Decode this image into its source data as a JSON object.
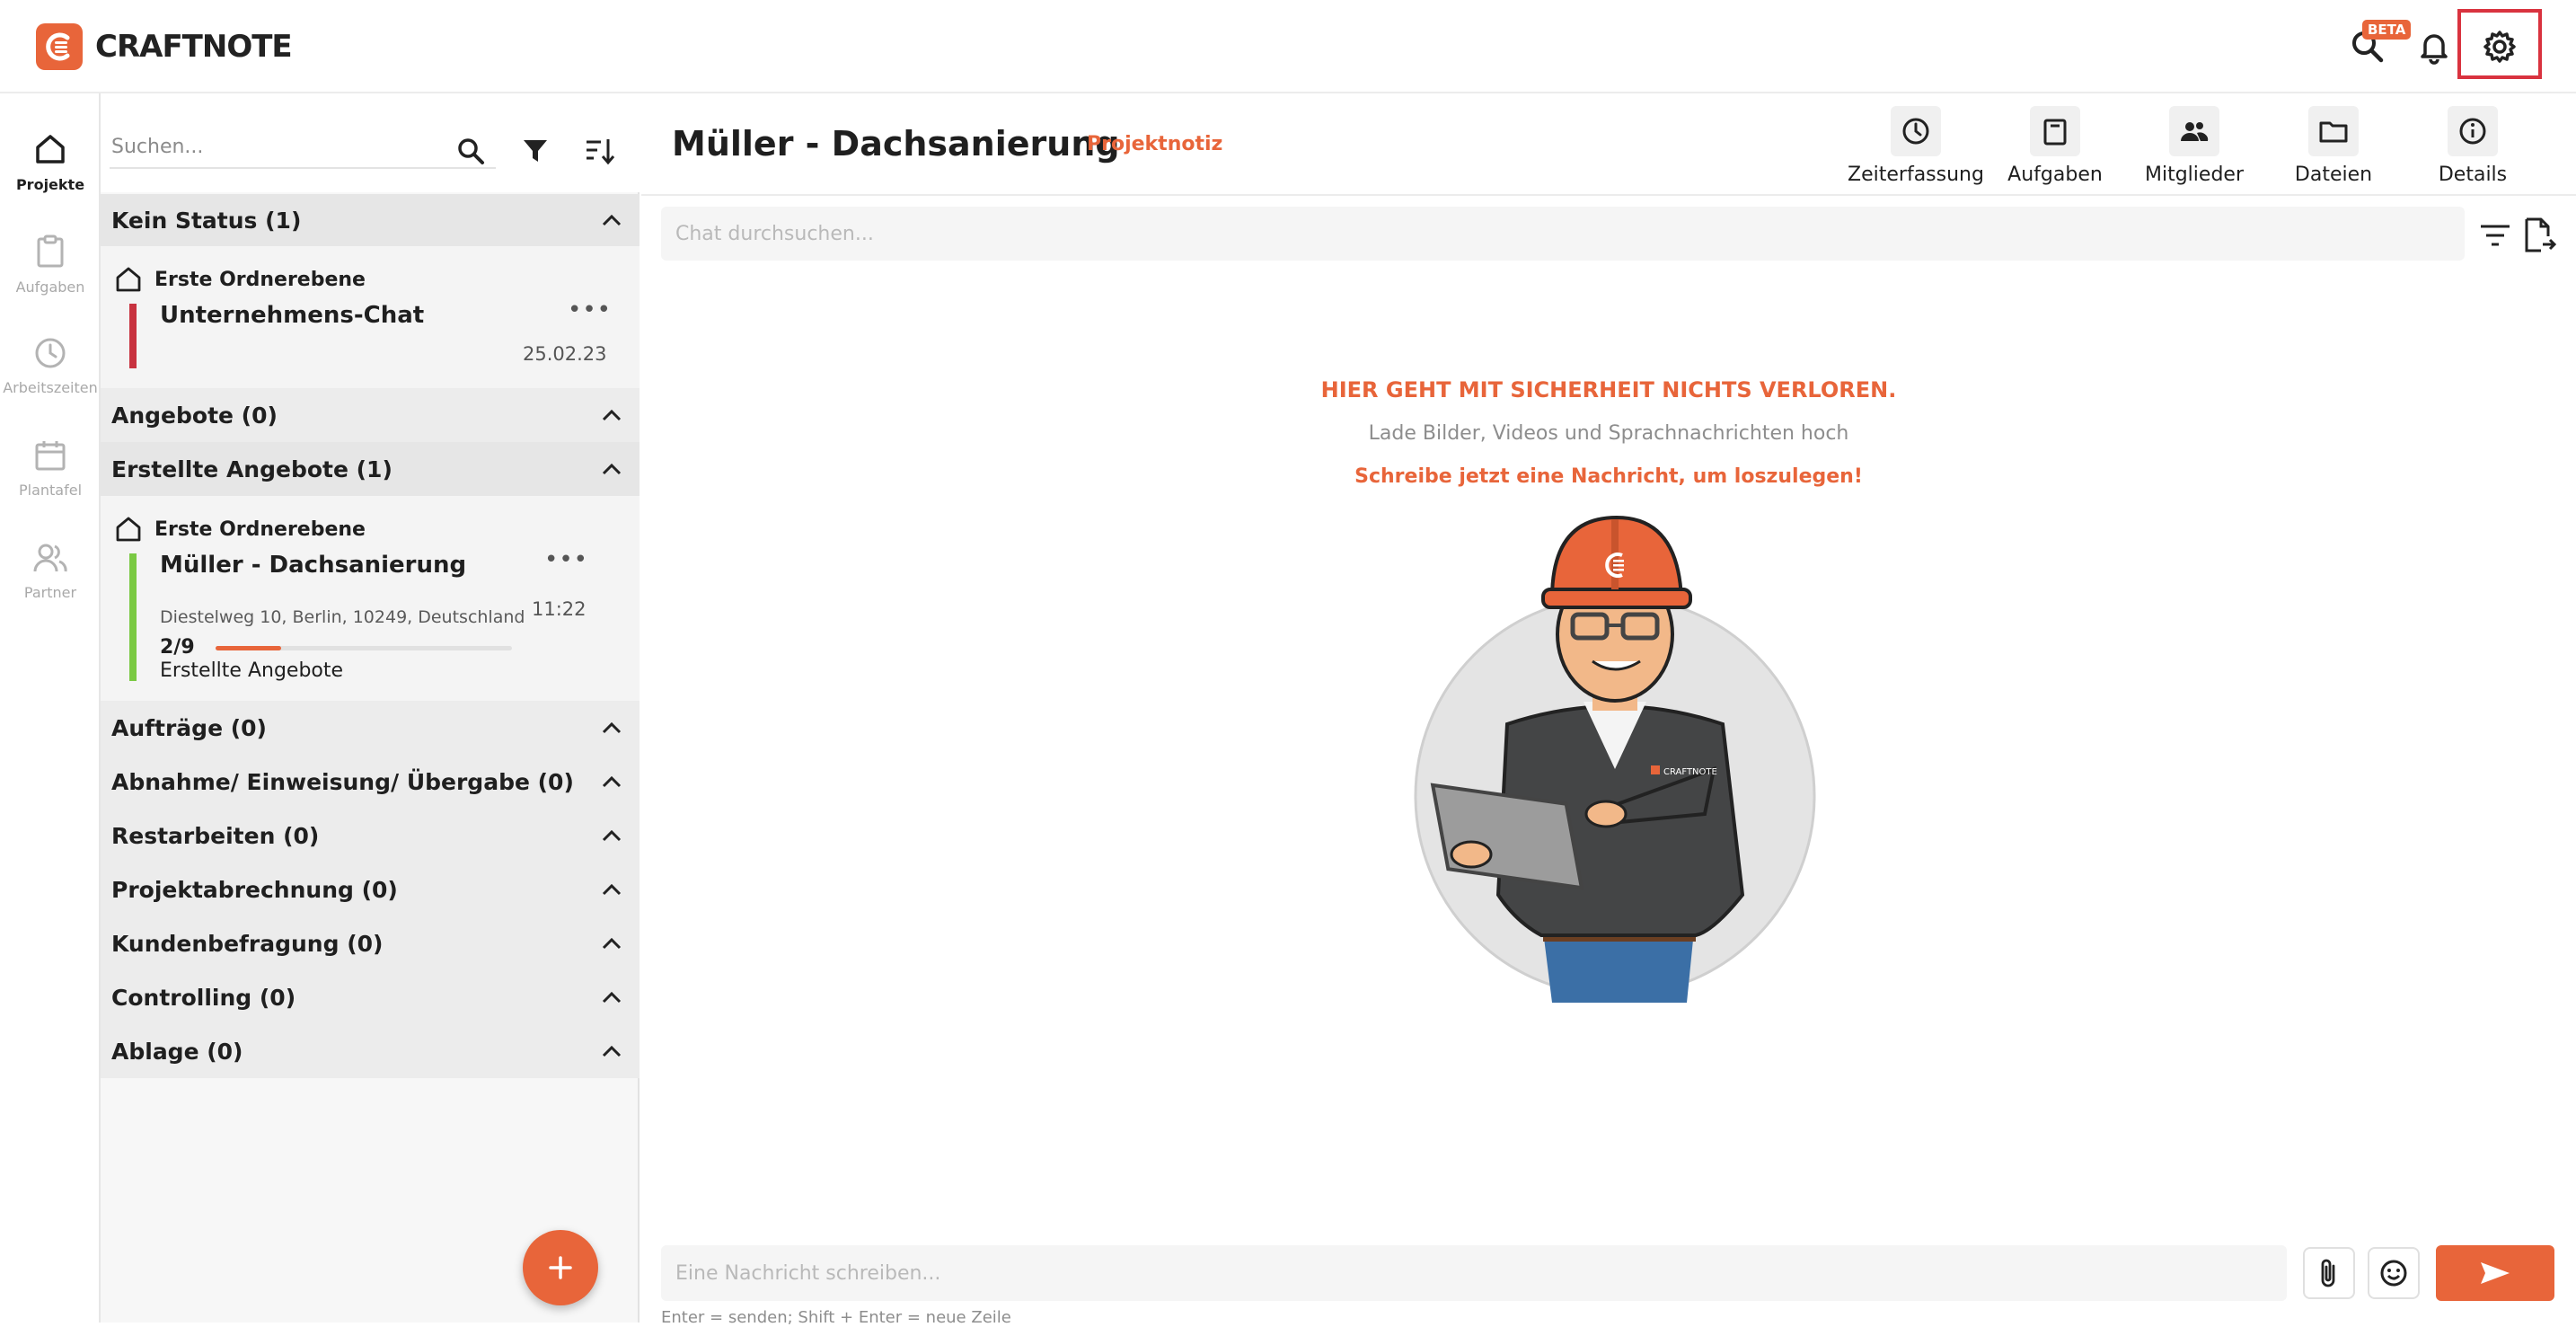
{
  "app": {
    "logo_text": "CRAFTNOTE",
    "beta_badge": "BETA"
  },
  "rail": [
    {
      "label": "Projekte"
    },
    {
      "label": "Aufgaben"
    },
    {
      "label": "Arbeitszeiten"
    },
    {
      "label": "Plantafel"
    },
    {
      "label": "Partner"
    }
  ],
  "list": {
    "search_placeholder": "Suchen...",
    "groups": [
      {
        "title": "Kein Status (1)"
      },
      {
        "title": "Angebote (0)"
      },
      {
        "title": "Erstellte Angebote (1)"
      },
      {
        "title": "Aufträge (0)"
      },
      {
        "title": "Abnahme/ Einweisung/ Übergabe (0)"
      },
      {
        "title": "Restarbeiten (0)"
      },
      {
        "title": "Projektabrechnung (0)"
      },
      {
        "title": "Kundenbefragung (0)"
      },
      {
        "title": "Controlling (0)"
      },
      {
        "title": "Ablage (0)"
      }
    ],
    "projects": [
      {
        "folder": "Erste Ordnerebene",
        "title": "Unternehmens-Chat",
        "date": "25.02.23",
        "status_color": "#c8323f"
      },
      {
        "folder": "Erste Ordnerebene",
        "title": "Müller - Dachsanierung",
        "address": "Diestelweg 10, Berlin, 10249, Deutschland",
        "count": "2/9",
        "progress": 0.22,
        "status": "Erstellte Angebote",
        "time": "11:22",
        "status_color": "#7ac943"
      }
    ]
  },
  "chat": {
    "title": "Müller - Dachsanierung",
    "tag": "Projektnotiz",
    "tools": [
      {
        "label": "Zeiterfassung"
      },
      {
        "label": "Aufgaben"
      },
      {
        "label": "Mitglieder"
      },
      {
        "label": "Dateien"
      },
      {
        "label": "Details"
      }
    ],
    "search_placeholder": "Chat durchsuchen...",
    "empty_headline": "HIER GEHT MIT SICHERHEIT NICHTS VERLOREN.",
    "empty_sub": "Lade Bilder, Videos und Sprachnachrichten hoch",
    "empty_cta": "Schreibe jetzt eine Nachricht, um loszulegen!",
    "mascot_logo_text": "CRAFTNOTE",
    "message_placeholder": "Eine Nachricht schreiben...",
    "hint": "Enter = senden; Shift + Enter = neue Zeile"
  },
  "colors": {
    "accent": "#e8653a",
    "highlight": "#d9333f"
  }
}
